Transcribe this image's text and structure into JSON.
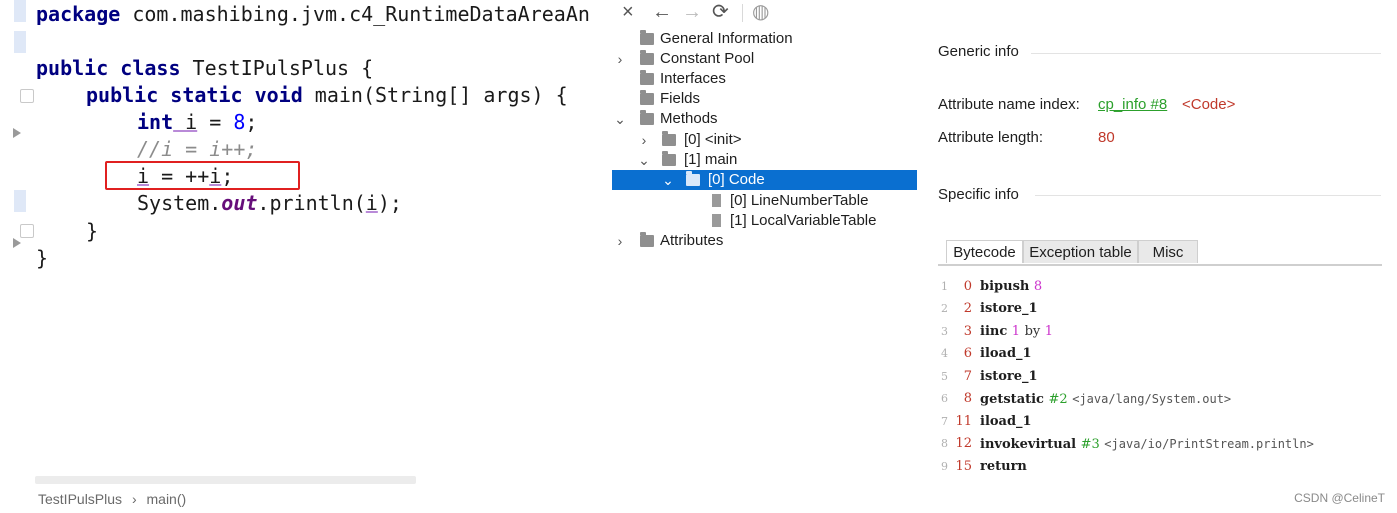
{
  "editor": {
    "lines": {
      "package_kw": "package",
      "package_name": " com.mashibing.jvm.c4_RuntimeDataAreaAn",
      "class_kw": "public class",
      "class_name": " TestIPulsPlus {",
      "method_kw": "public static void",
      "method_sig": " main(String[] args) {",
      "int_kw": "int",
      "int_var": " i",
      "int_eq": " = ",
      "int_val": "8",
      "int_end": ";",
      "comment": "//i = i++;",
      "incr_a": "i",
      "incr_b": " = ++",
      "incr_c": "i",
      "incr_d": ";",
      "print_a": "System.",
      "print_b": "out",
      "print_c": ".println(",
      "print_d": "i",
      "print_e": ");",
      "close_method": "}",
      "close_class": "}"
    },
    "breadcrumb": {
      "class": "TestIPulsPlus",
      "sep": "›",
      "method": "main()"
    }
  },
  "toolbar": {
    "close": "×",
    "back": "←",
    "forward": "→",
    "refresh": "⟳",
    "web": "◍"
  },
  "tree": {
    "items": [
      {
        "label": "General Information"
      },
      {
        "label": "Constant Pool"
      },
      {
        "label": "Interfaces"
      },
      {
        "label": "Fields"
      },
      {
        "label": "Methods"
      },
      {
        "label": "[0] <init>"
      },
      {
        "label": "[1] main"
      },
      {
        "label": "[0] Code"
      },
      {
        "label": "[0] LineNumberTable"
      },
      {
        "label": "[1] LocalVariableTable"
      },
      {
        "label": "Attributes"
      }
    ]
  },
  "details": {
    "generic_title": "Generic info",
    "attr_name_label": "Attribute name index:",
    "attr_name_link": "cp_info #8",
    "attr_name_value": "<Code>",
    "attr_len_label": "Attribute length:",
    "attr_len_value": "80",
    "specific_title": "Specific info",
    "tabs": [
      "Bytecode",
      "Exception table",
      "Misc"
    ],
    "bytecode": [
      {
        "line": "1",
        "offset": "0",
        "op": "bipush",
        "arg": "8"
      },
      {
        "line": "2",
        "offset": "2",
        "op": "istore_1"
      },
      {
        "line": "3",
        "offset": "3",
        "op": "iinc",
        "arg": "1",
        "by": "by",
        "arg2": "1"
      },
      {
        "line": "4",
        "offset": "6",
        "op": "iload_1"
      },
      {
        "line": "5",
        "offset": "7",
        "op": "istore_1"
      },
      {
        "line": "6",
        "offset": "8",
        "op": "getstatic",
        "ref": "#2",
        "comment": "<java/lang/System.out>"
      },
      {
        "line": "7",
        "offset": "11",
        "op": "iload_1"
      },
      {
        "line": "8",
        "offset": "12",
        "op": "invokevirtual",
        "ref": "#3",
        "comment": "<java/io/PrintStream.println>"
      },
      {
        "line": "9",
        "offset": "15",
        "op": "return"
      }
    ]
  },
  "watermark": "CSDN @CelineT",
  "colors": {
    "selection": "#0a6fd0",
    "highlight_box": "#e02020",
    "link": "#2ca02c",
    "value": "#c0392b"
  }
}
